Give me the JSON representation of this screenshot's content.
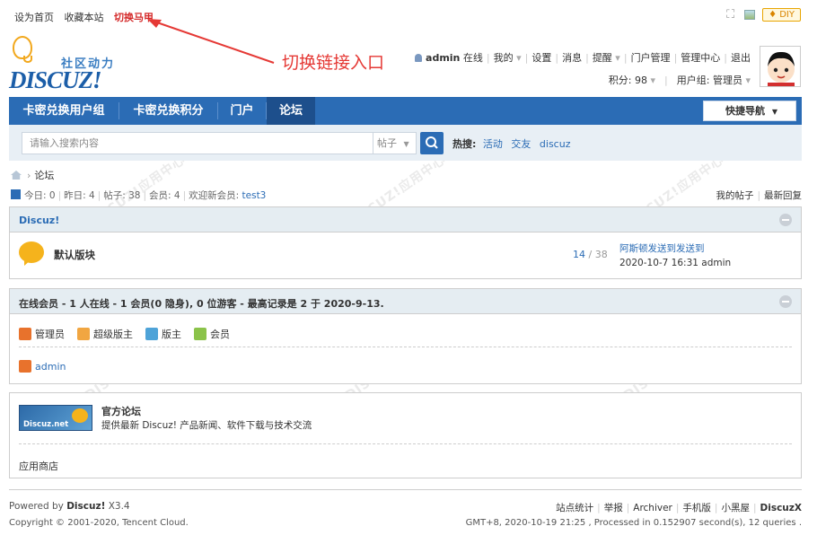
{
  "topbar": {
    "set_home": "设为首页",
    "bookmark": "收藏本站",
    "switch_account": "切换马甲",
    "diy_label": "DIY"
  },
  "annotation": {
    "text": "切换链接入口",
    "color": "#e53935"
  },
  "logo": {
    "cn": "社区动力",
    "en": "DISCUZ!"
  },
  "user": {
    "name": "admin",
    "status": "在线",
    "links": [
      "我的",
      "设置",
      "消息",
      "提醒",
      "门户管理",
      "管理中心",
      "退出"
    ],
    "points_label": "积分: 98",
    "group_label": "用户组: 管理员"
  },
  "nav": {
    "items": [
      {
        "label": "卡密兑换用户组"
      },
      {
        "label": "卡密兑换积分"
      },
      {
        "label": "门户"
      },
      {
        "label": "论坛"
      }
    ],
    "quick_nav": "快捷导航"
  },
  "search": {
    "placeholder": "请输入搜索内容",
    "type": "帖子",
    "hot_label": "热搜:",
    "hot_terms": [
      "活动",
      "交友",
      "discuz"
    ]
  },
  "breadcrumb": {
    "current": "论坛"
  },
  "stats": {
    "today": "今日: 0",
    "yesterday": "昨日: 4",
    "posts": "帖子: 38",
    "members": "会员: 4",
    "welcome": "欢迎新会员:",
    "new_member": "test3",
    "my_posts": "我的帖子",
    "latest_replies": "最新回复"
  },
  "forum_box": {
    "title": "Discuz!",
    "forum_name": "默认版块",
    "count_threads": "14",
    "count_sep": " / ",
    "count_posts": "38",
    "last_title": "阿斯顿发送到发送到",
    "last_meta": "2020-10-7 16:31 admin"
  },
  "online_box": {
    "title": "在线会员 - 1 人在线 - 1 会员(0 隐身), 0 位游客 - 最高记录是 2 于 2020-9-13.",
    "legend": [
      {
        "label": "管理员",
        "color": "#e8722c"
      },
      {
        "label": "超级版主",
        "color": "#f1a641"
      },
      {
        "label": "版主",
        "color": "#4ea3d8"
      },
      {
        "label": "会员",
        "color": "#8bc34a"
      }
    ],
    "users": [
      "admin"
    ]
  },
  "partner_box": {
    "logo_caption": "Discuz.net",
    "name": "官方论坛",
    "desc": "提供最新 Discuz! 产品新闻、软件下载与技术交流",
    "appstore": "应用商店"
  },
  "footer": {
    "powered_prefix": "Powered by",
    "powered_name": "Discuz!",
    "version": "X3.4",
    "copyright": "Copyright © 2001-2020, Tencent Cloud.",
    "links": [
      "站点统计",
      "举报",
      "Archiver",
      "手机版",
      "小黑屋"
    ],
    "brand": "DiscuzX",
    "runtime": "GMT+8, 2020-10-19 21:25 , Processed in 0.152907 second(s), 12 queries ."
  },
  "colors": {
    "nav_bg": "#2b6cb5",
    "link": "#2b6cb5",
    "switch_link": "#d42a2a"
  }
}
